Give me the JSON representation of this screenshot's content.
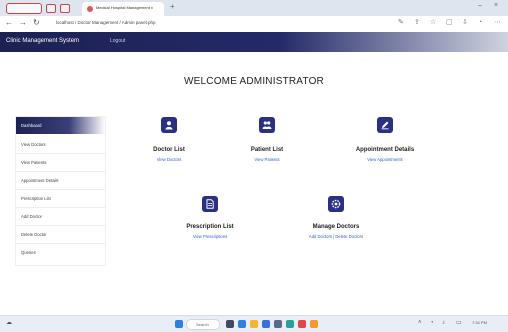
{
  "browser": {
    "tab_title": "Medical Hospital Management x",
    "url": "localhost / Doctor Management / Admin panel.php",
    "window_controls": {
      "minimize": "–",
      "close": "×"
    },
    "nav": {
      "back": "←",
      "forward": "→",
      "reload": "↻"
    },
    "new_tab": "+"
  },
  "app": {
    "brand": "Clinic Management System",
    "logout": "Logout"
  },
  "welcome": "WELCOME ADMINISTRATOR",
  "sidebar": {
    "items": [
      {
        "label": "Dashboard"
      },
      {
        "label": "View Doctors"
      },
      {
        "label": "View Patients"
      },
      {
        "label": "Appointment Details"
      },
      {
        "label": "Prescription List"
      },
      {
        "label": "Add Doctor"
      },
      {
        "label": "Delete Doctor"
      },
      {
        "label": "Queries"
      }
    ]
  },
  "cards": [
    {
      "title": "Doctor List",
      "link": "View Doctors",
      "icon": "user-icon"
    },
    {
      "title": "Patient List",
      "link": "View Patients",
      "icon": "users-icon"
    },
    {
      "title": "Appointment Details",
      "link": "View Appointments",
      "icon": "pen-icon"
    },
    {
      "title": "Prescription List",
      "link": "View Prescriptions",
      "icon": "document-icon"
    },
    {
      "title": "Manage Doctors",
      "link": "Add Doctors | Delete Doctors",
      "icon": "gear-icon"
    }
  ],
  "taskbar": {
    "search_label": "Search",
    "clock": "7:34 PM"
  },
  "colors": {
    "header_dark": "#1d2152",
    "icon_bg": "#2b3182",
    "link": "#2a62c9"
  }
}
